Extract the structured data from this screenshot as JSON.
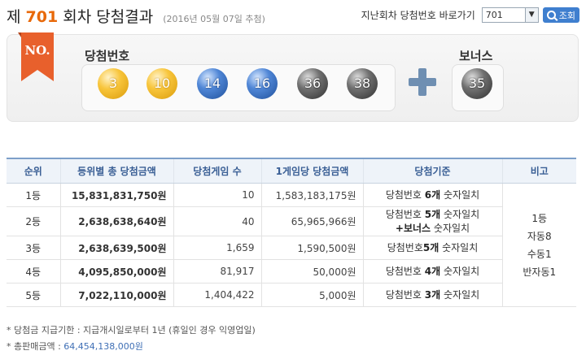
{
  "header": {
    "title_prefix": "제",
    "draw_number": "701",
    "title_suffix": "회차 당첨결과",
    "date": "(2016년 05월 07일 추첨)",
    "jump_label": "지난회차 당첨번호 바로가기",
    "select_value": "701",
    "search_label": "조회"
  },
  "panel": {
    "ribbon": "NO.",
    "winning_label": "당첨번호",
    "bonus_label": "보너스",
    "numbers": [
      "3",
      "10",
      "14",
      "16",
      "36",
      "38"
    ],
    "bonus": "35",
    "colors": {
      "yellow": "#f8c53b",
      "blue": "#4f86d6",
      "gray": "#707070",
      "ribbon": "#e8602c"
    }
  },
  "table": {
    "headers": [
      "순위",
      "등위별 총 당첨금액",
      "당첨게임 수",
      "1게임당 당첨금액",
      "당첨기준",
      "비고"
    ],
    "rows": [
      {
        "rank": "1등",
        "total": "15,831,831,750원",
        "count": "10",
        "per": "1,583,183,175원",
        "crit_a": "당첨번호 ",
        "crit_b": "6개",
        "crit_c": " 숫자일치"
      },
      {
        "rank": "2등",
        "total": "2,638,638,640원",
        "count": "40",
        "per": "65,965,966원",
        "crit_a": "당첨번호 ",
        "crit_b": "5개",
        "crit_c": " 숫자일치",
        "crit_d": "+보너스",
        "crit_e": " 숫자일치"
      },
      {
        "rank": "3등",
        "total": "2,638,639,500원",
        "count": "1,659",
        "per": "1,590,500원",
        "crit_a": "당첨번호",
        "crit_b": "5개",
        "crit_c": " 숫자일치"
      },
      {
        "rank": "4등",
        "total": "4,095,850,000원",
        "count": "81,917",
        "per": "50,000원",
        "crit_a": "당첨번호 ",
        "crit_b": "4개",
        "crit_c": " 숫자일치"
      },
      {
        "rank": "5등",
        "total": "7,022,110,000원",
        "count": "1,404,422",
        "per": "5,000원",
        "crit_a": "당첨번호 ",
        "crit_b": "3개",
        "crit_c": " 숫자일치"
      }
    ],
    "note": [
      "1등",
      "자동8",
      "수동1",
      "반자동1"
    ]
  },
  "footer": {
    "deadline": "* 당첨금 지급기한 : 지급개시일로부터 1년 (휴일인 경우 익영업일)",
    "sales_label": "* 총판매금액 : ",
    "sales_value": "64,454,138,000원"
  }
}
